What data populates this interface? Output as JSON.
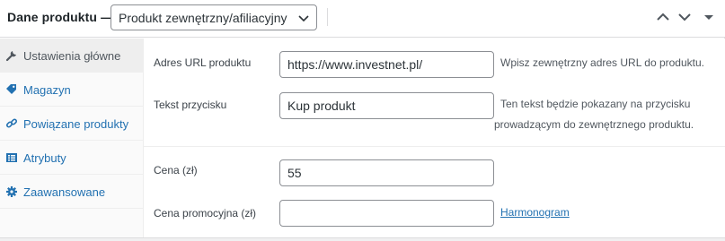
{
  "header": {
    "title": "Dane produktu —",
    "product_type": "Produkt zewnętrzny/afiliacyjny",
    "icons": [
      "chevron-up-icon",
      "chevron-down-icon",
      "caret-down-icon"
    ]
  },
  "sidebar": {
    "items": [
      {
        "label": "Ustawienia główne",
        "icon": "wrench-icon",
        "active": true
      },
      {
        "label": "Magazyn",
        "icon": "tag-icon",
        "active": false
      },
      {
        "label": "Powiązane produkty",
        "icon": "link-icon",
        "active": false
      },
      {
        "label": "Atrybuty",
        "icon": "list-icon",
        "active": false
      },
      {
        "label": "Zaawansowane",
        "icon": "gear-icon",
        "active": false
      }
    ]
  },
  "fields": {
    "url": {
      "label": "Adres URL produktu",
      "value": "https://www.investnet.pl/",
      "help": "Wpisz zewnętrzny adres URL do produktu."
    },
    "button_text": {
      "label": "Tekst przycisku",
      "value": "Kup produkt",
      "help_line1": "Ten tekst będzie pokazany na przycisku",
      "help_line2": "prowadzącym do zewnętrznego produktu."
    },
    "price": {
      "label": "Cena (zł)",
      "value": "55"
    },
    "sale_price": {
      "label": "Cena promocyjna (zł)",
      "value": "",
      "schedule_link": "Harmonogram"
    }
  },
  "colors": {
    "link": "#2271b1",
    "border": "#dcdcde",
    "sidebar_bg": "#fafafa",
    "active_bg": "#eeeeee"
  }
}
